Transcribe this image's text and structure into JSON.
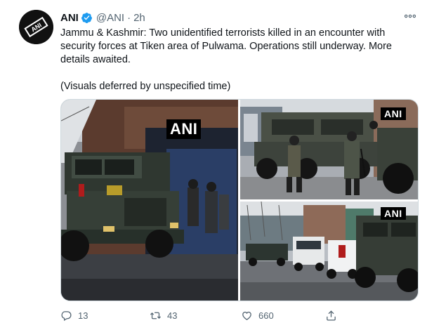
{
  "author": {
    "name": "ANI",
    "handle": "@ANI",
    "separator": "·",
    "time": "2h",
    "avatar_text": "ANI"
  },
  "tweet": {
    "line1": "Jammu & Kashmir: Two unidentified terrorists killed in an encounter with security forces at Tiken area of Pulwama. Operations still underway. More details awaited.",
    "line2": "(Visuals deferred by unspecified time)"
  },
  "media": {
    "watermark": "ANI"
  },
  "actions": {
    "replies": "13",
    "retweets": "43",
    "likes": "660"
  },
  "colors": {
    "verified": "#1d9bf0",
    "muted": "#536471"
  },
  "icons": [
    "verified-badge-icon",
    "more-icon",
    "reply-icon",
    "retweet-icon",
    "like-icon",
    "share-icon"
  ]
}
